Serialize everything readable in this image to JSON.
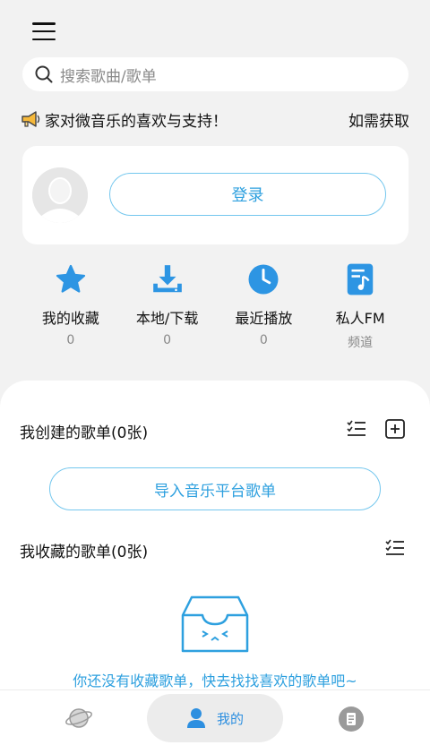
{
  "search": {
    "placeholder": "搜索歌曲/歌单"
  },
  "marquee": {
    "text_a": "家对微音乐的喜欢与支持！",
    "text_b": "如需获取"
  },
  "login": {
    "button_label": "登录"
  },
  "quick_actions": [
    {
      "icon": "star-icon",
      "label": "我的收藏",
      "sub": "0"
    },
    {
      "icon": "download-icon",
      "label": "本地/下载",
      "sub": "0"
    },
    {
      "icon": "clock-icon",
      "label": "最近播放",
      "sub": "0"
    },
    {
      "icon": "music-note-icon",
      "label": "私人FM",
      "sub": "频道"
    }
  ],
  "created": {
    "title": "我创建的歌单(0张)",
    "import_label": "导入音乐平台歌单"
  },
  "collected": {
    "title": "我收藏的歌单(0张)",
    "empty_text": "你还没有收藏歌单，快去找找喜欢的歌单吧~"
  },
  "tabbar": {
    "active_label": "我的"
  },
  "colors": {
    "accent": "#2ea0df",
    "accent_border": "#74c7ee"
  }
}
